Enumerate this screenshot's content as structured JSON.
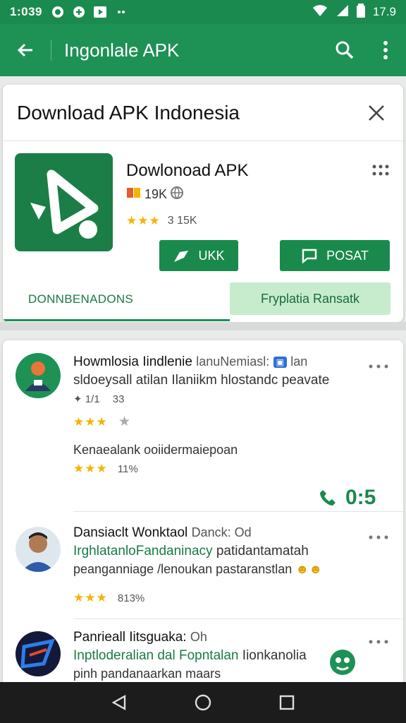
{
  "status_bar": {
    "time": "1:039",
    "battery": "17.9"
  },
  "app_bar": {
    "title": "Ingonlale APK"
  },
  "top_card": {
    "title": "Download APK Indonesia",
    "app_name": "Dowlonoad APK",
    "meta": "19K",
    "rating_text": "3 15K",
    "stars": "★★★",
    "btn_left": "UKK",
    "btn_right": "POSAT",
    "tab_left": "DONNBENADONS",
    "tab_right": "Fryplatia Ransatk"
  },
  "reviews": [
    {
      "title": "Howmlosia Iindlenie",
      "title_sub": "lanuNemiasl:",
      "title_tail": "lan",
      "line1": "sldoeysall atilan Ilaniikm hlostandc peavate",
      "meta": "1/1",
      "meta2": "33",
      "stars": "★★★",
      "star_empty": "★",
      "line2": "Kenaealank ooiidermaiepoan",
      "rating": "11%",
      "stars2": "★★★",
      "side_text": "0:5"
    },
    {
      "title": "Dansiaclt Wonktaol",
      "title_sub": "Danck: Od",
      "line_green": "IrghlatanloFandaninacy",
      "line_green_tail": "patidantamatah",
      "line2": "peanganniage /lenoukan pastaranstlan",
      "stars": "★★★",
      "rating": "813%"
    },
    {
      "title": "Panrieall Iitsguaka:",
      "title_sub": "Oh",
      "line_green": "Inptloderalian dal Fopntalan",
      "line_tail": "Iionkanolia",
      "line2": "pinh pandanaarkan maars"
    }
  ],
  "colors": {
    "primary": "#1e9155",
    "dark": "#1a8a4c",
    "accent_light": "#c7eccd",
    "star": "#f4b400"
  },
  "icons": [
    "back-arrow-icon",
    "search-icon",
    "more-vert-icon",
    "close-icon",
    "grid-dots-icon",
    "back-nav-icon",
    "home-nav-icon",
    "recents-nav-icon"
  ]
}
